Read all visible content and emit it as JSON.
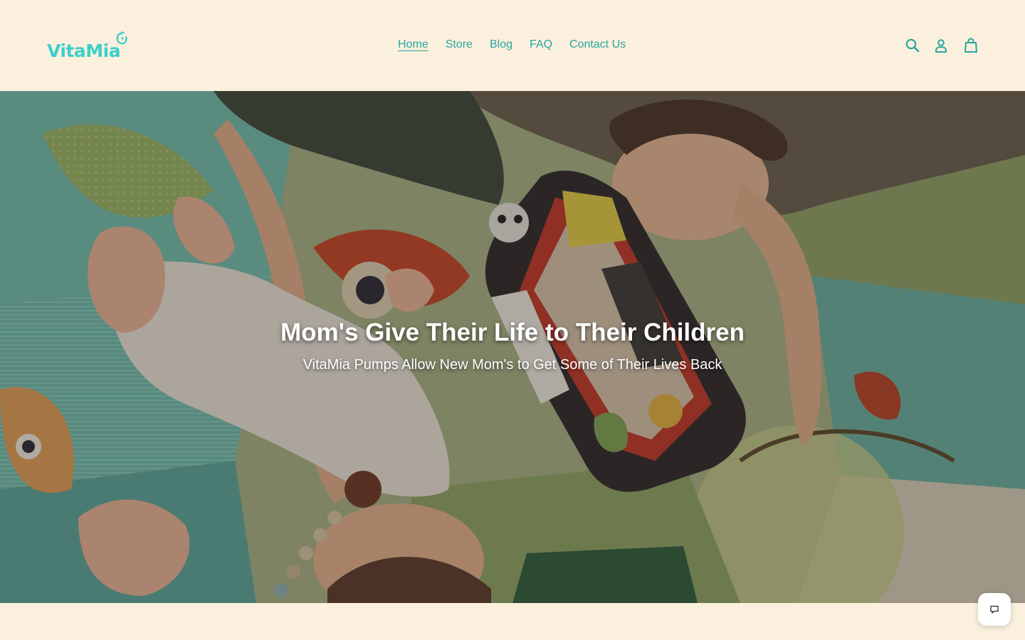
{
  "brand": {
    "name": "VitaMia",
    "logo_color": "#3fcfc9",
    "accent_color": "#2aa6a1",
    "background_color": "#fbf0dd"
  },
  "nav": {
    "items": [
      {
        "label": "Home",
        "active": true
      },
      {
        "label": "Store",
        "active": false
      },
      {
        "label": "Blog",
        "active": false
      },
      {
        "label": "FAQ",
        "active": false
      },
      {
        "label": "Contact Us",
        "active": false
      }
    ]
  },
  "header_icons": [
    "search-icon",
    "account-icon",
    "cart-icon"
  ],
  "hero": {
    "title": "Mom's Give Their Life to Their Children",
    "subtitle": "VitaMia Pumps Allow New Mom's to Get Some of Their Lives Back"
  },
  "chat": {
    "icon": "chat-icon"
  }
}
